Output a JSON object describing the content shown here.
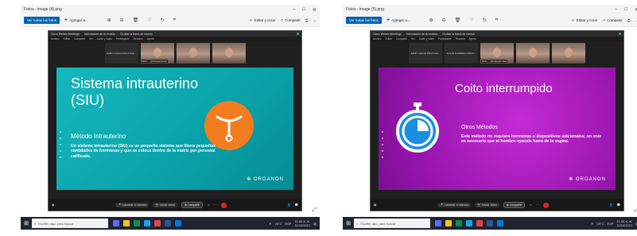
{
  "screens": [
    {
      "window_title": "Fotos - image (4).png",
      "toolbar": {
        "all_photos": "Ver todas las fotos",
        "add": "Agregar a...",
        "edit": "Editar y crear",
        "share": "Compartir"
      },
      "zoom_bar": {
        "app": "Cisco Webex Meetings",
        "info": "Información de la reunión",
        "hide": "Ocultar la barra de menús"
      },
      "zoom_menu": [
        "Archivo",
        "Editar",
        "Compartir",
        "Ver",
        "Audio y video",
        "Participante",
        "Reunión",
        "Ayuda"
      ],
      "thumbs": [
        {
          "caption": "Judith Lorenna Pérez Hua...",
          "face": false
        },
        {
          "caption": "Ruth ... @Gdpgamidsal",
          "face": true
        },
        {
          "caption": "",
          "face": true
        },
        {
          "caption": "",
          "face": true
        }
      ],
      "slide": {
        "theme": "teal",
        "title": "Sistema intrauterino (SIU)",
        "subtitle": "Método Intrauterino",
        "body": "Un sistema intrauterino (SIU) es un pequeño sistema que libera pequeñas cantidades de hormonas y que se coloca dentro de la matriz por personal calificado.",
        "logo": "ORGANON",
        "icon": "iud-icon"
      },
      "zoom_controls": {
        "mute": "Cancelar el silencio",
        "video": "Iniciar video",
        "share": "Compartir"
      },
      "taskbar": {
        "search": "Escribe aquí para buscar",
        "weather": "24°C",
        "lang": "ESP",
        "time": "11:44 a. m.",
        "date": "11/10/2021"
      }
    },
    {
      "window_title": "Fotos - image (5).png",
      "toolbar": {
        "all_photos": "Ver todas las fotos",
        "add": "Agregar a...",
        "edit": "Editar y crear",
        "share": "Compartir"
      },
      "zoom_bar": {
        "app": "Cisco Webex Meetings",
        "info": "Información de la reunión",
        "hide": "Ocultar la barra de menús"
      },
      "zoom_menu": [
        "Archivo",
        "Editar",
        "Compartir",
        "Ver",
        "Audio y video",
        "Participante",
        "Reunión",
        "Ayuda"
      ],
      "thumbs": [
        {
          "caption": "Judith Lorenna Pérez Hua...",
          "face": false
        },
        {
          "caption": "Lorena Guadalupe Alarco...",
          "face": false
        },
        {
          "caption": "Ruth ... @Gdpgamidsal",
          "face": true
        },
        {
          "caption": "",
          "face": true
        },
        {
          "caption": "",
          "face": true
        }
      ],
      "slide": {
        "theme": "purple",
        "title": "Coito interrumpido",
        "subtitle": "Otros Métodos",
        "body": "Este método no requiere hormonas o dispositivos adicionales; en este es necesario que el hombre eyacule fuera de la vagina.",
        "logo": "ORGANON",
        "icon": "stopwatch-icon"
      },
      "zoom_controls": {
        "mute": "Cancelar el silencio",
        "video": "Iniciar video",
        "share": "Compartir"
      },
      "taskbar": {
        "search": "Escribe aquí para buscar",
        "weather": "24°C",
        "lang": "ESP",
        "time": "11:44 a. m.",
        "date": "11/10/2021"
      }
    }
  ],
  "colors": {
    "teal": "#0aa1a8",
    "purple": "#9d17b3",
    "organon_orange": "#f47c20",
    "zoom_dark": "#1f1f1f",
    "taskbar": "#1f2430"
  }
}
